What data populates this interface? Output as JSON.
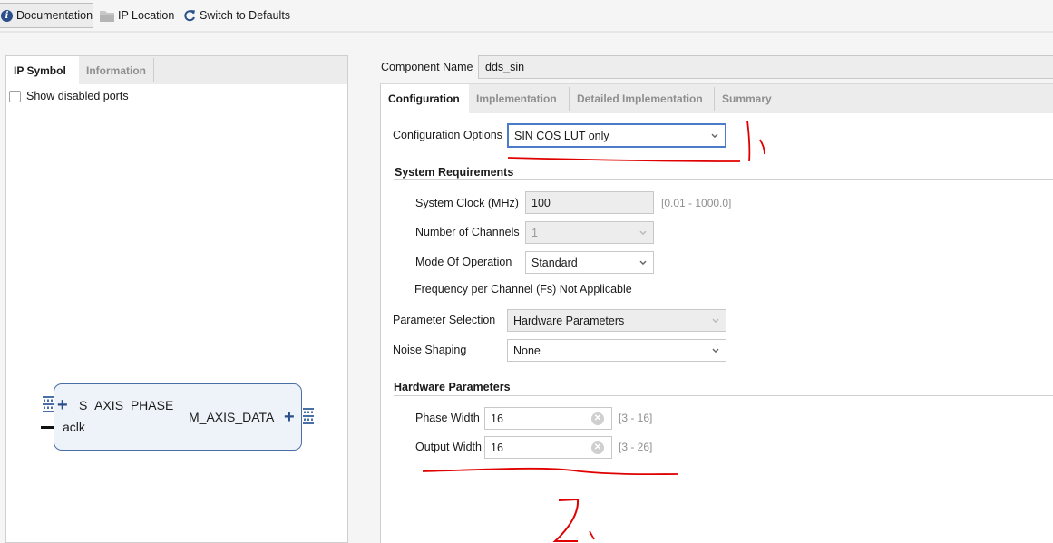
{
  "toolbar": {
    "documentation": "Documentation",
    "ip_location": "IP Location",
    "switch_defaults": "Switch to Defaults"
  },
  "left_panel": {
    "tabs": [
      "IP Symbol",
      "Information"
    ],
    "active_tab": "IP Symbol",
    "show_disabled_ports": {
      "label": "Show disabled ports",
      "checked": false
    },
    "ip_symbol": {
      "ports_left": [
        "S_AXIS_PHASE",
        "aclk"
      ],
      "ports_right": [
        "M_AXIS_DATA"
      ]
    }
  },
  "component": {
    "label": "Component Name",
    "value": "dds_sin"
  },
  "tabs": [
    "Configuration",
    "Implementation",
    "Detailed Implementation",
    "Summary"
  ],
  "active_tab": "Configuration",
  "configuration": {
    "config_options": {
      "label": "Configuration Options",
      "value": "SIN COS LUT only"
    },
    "system_requirements": {
      "title": "System Requirements",
      "system_clock": {
        "label": "System Clock (MHz)",
        "value": "100",
        "range": "[0.01 - 1000.0]"
      },
      "num_channels": {
        "label": "Number of Channels",
        "value": "1"
      },
      "mode_of_operation": {
        "label": "Mode Of Operation",
        "value": "Standard"
      },
      "fs_text": "Frequency per Channel (Fs) Not Applicable"
    },
    "parameter_selection": {
      "label": "Parameter Selection",
      "value": "Hardware Parameters"
    },
    "noise_shaping": {
      "label": "Noise Shaping",
      "value": "None"
    },
    "hardware_parameters": {
      "title": "Hardware Parameters",
      "phase_width": {
        "label": "Phase Width",
        "value": "16",
        "range": "[3 - 16]"
      },
      "output_width": {
        "label": "Output Width",
        "value": "16",
        "range": "[3 - 26]"
      }
    }
  },
  "annotations": {
    "color": "#e00000",
    "marks": [
      "1、",
      "2、"
    ]
  },
  "colors": {
    "accent_focus": "#4a7cc9",
    "ip_block_border": "#4a6fa5",
    "icon_blue": "#2b4f8a"
  }
}
